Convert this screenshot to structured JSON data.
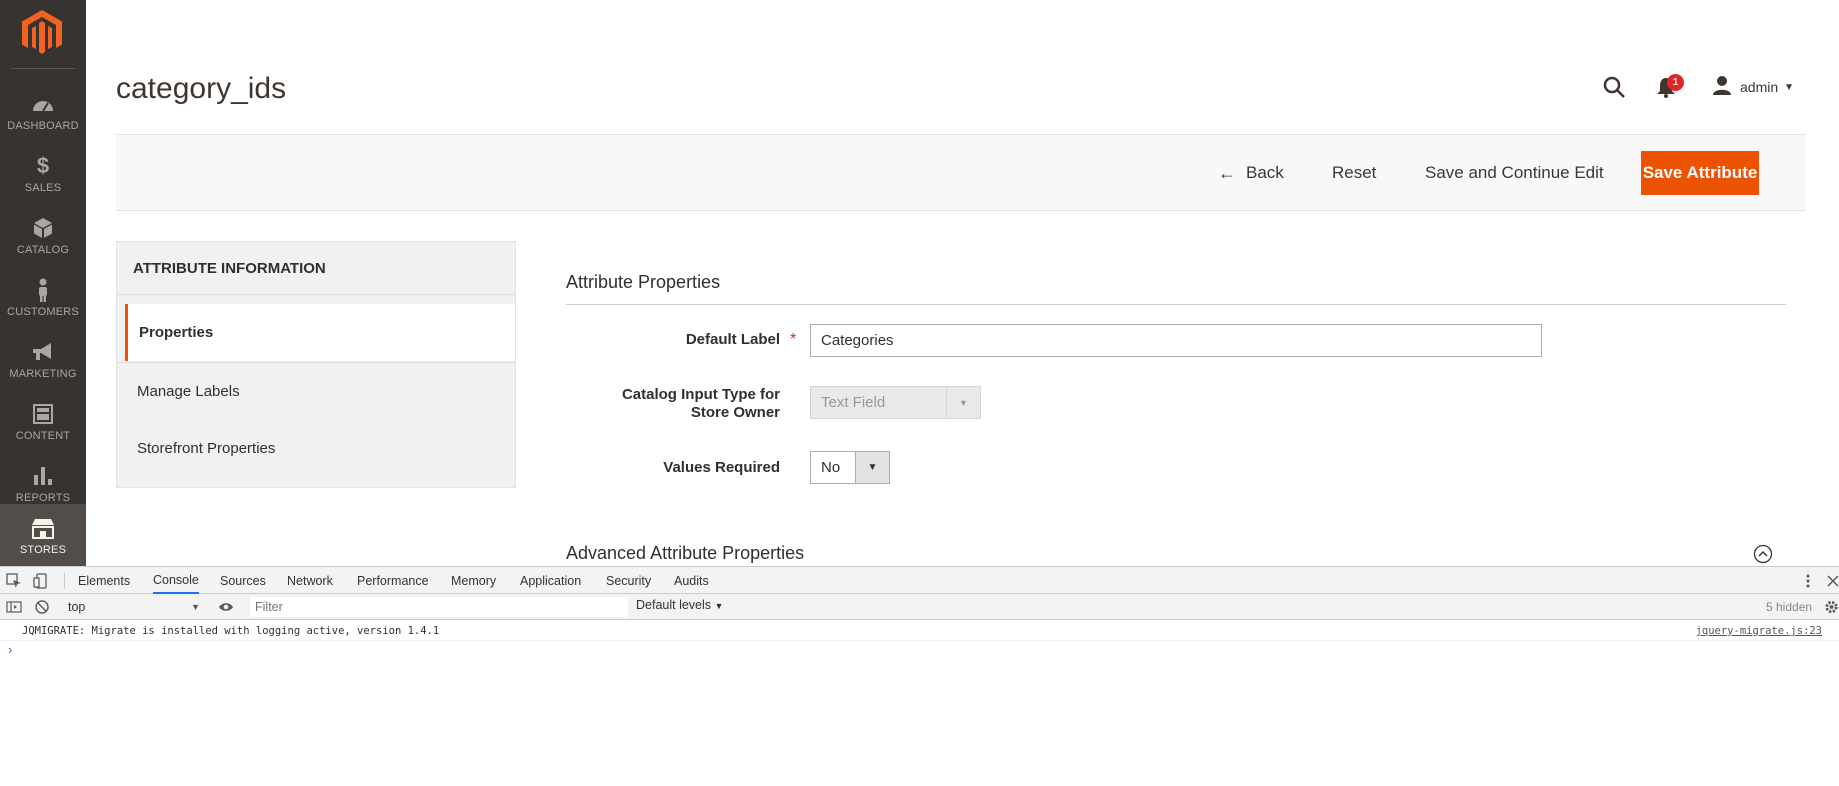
{
  "sidebar": {
    "items": [
      {
        "label": "DASHBOARD",
        "icon": "dashboard-icon"
      },
      {
        "label": "SALES",
        "icon": "dollar-icon"
      },
      {
        "label": "CATALOG",
        "icon": "box-icon"
      },
      {
        "label": "CUSTOMERS",
        "icon": "person-icon"
      },
      {
        "label": "MARKETING",
        "icon": "megaphone-icon"
      },
      {
        "label": "CONTENT",
        "icon": "content-icon"
      },
      {
        "label": "REPORTS",
        "icon": "bar-chart-icon"
      },
      {
        "label": "STORES",
        "icon": "store-icon",
        "active": true
      }
    ]
  },
  "header": {
    "title": "category_ids",
    "notification_count": "1",
    "user": "admin"
  },
  "actions": {
    "back": "Back",
    "reset": "Reset",
    "save_continue": "Save and Continue Edit",
    "save": "Save Attribute"
  },
  "tabs": {
    "title": "ATTRIBUTE INFORMATION",
    "items": [
      "Properties",
      "Manage Labels",
      "Storefront Properties"
    ],
    "active": "Properties"
  },
  "form": {
    "section_title": "Attribute Properties",
    "default_label": {
      "label": "Default Label",
      "value": "Categories",
      "required": "*"
    },
    "input_type": {
      "label": "Catalog Input Type for Store Owner",
      "value": "Text Field"
    },
    "values_required": {
      "label": "Values Required",
      "value": "No"
    },
    "advanced_title": "Advanced Attribute Properties"
  },
  "devtools": {
    "tabs": [
      "Elements",
      "Console",
      "Sources",
      "Network",
      "Performance",
      "Memory",
      "Application",
      "Security",
      "Audits"
    ],
    "active_tab": "Console",
    "context": "top",
    "filter_placeholder": "Filter",
    "levels": "Default levels",
    "hidden": "5 hidden",
    "message": "JQMIGRATE: Migrate is installed with logging active, version 1.4.1",
    "message_source": "jquery-migrate.js:23",
    "prompt": "›"
  },
  "colors": {
    "accent": "#eb5202",
    "sidebar_bg": "#373330",
    "sidebar_active": "#524d49",
    "badge": "#e22626"
  }
}
